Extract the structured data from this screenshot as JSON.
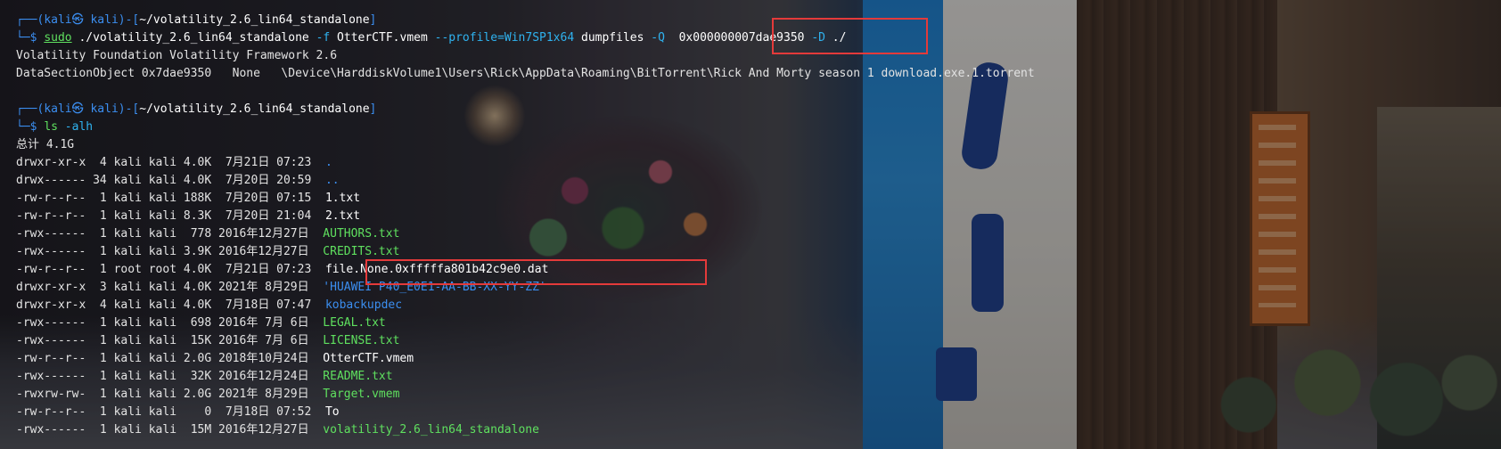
{
  "terminal": {
    "prompt_user": "kali",
    "prompt_host": "kali",
    "prompt_cwd": "~/volatility_2.6_lin64_standalone",
    "prompt_top_prefix": "┌──(",
    "prompt_glyph": "㉿",
    "prompt_mid": ")-[",
    "prompt_top_suffix": "]",
    "prompt_bottom": "└─$",
    "command1": {
      "sudo": "sudo",
      "exe": "./volatility_2.6_lin64_standalone",
      "flag_f": "-f",
      "file": "OtterCTF.vmem",
      "profile_opt": "--profile=Win7SP1x64",
      "plugin": "dumpfiles",
      "flag_Q": "-Q",
      "address": "0x000000007dae9350",
      "flag_D": "-D",
      "dir": "./"
    },
    "output1": [
      "Volatility Foundation Volatility Framework 2.6",
      "DataSectionObject 0x7dae9350   None   \\Device\\HarddiskVolume1\\Users\\Rick\\AppData\\Roaming\\BitTorrent\\Rick And Morty season 1 download.exe.1.torrent"
    ],
    "command2": {
      "exe": "ls",
      "args": "-alh"
    },
    "total_line": "总计 4.1G",
    "listing": [
      {
        "perm": "drwxr-xr-x",
        "links": " 4",
        "owner": "kali",
        "group": "kali",
        "size": "4.0K",
        "date": " 7月21日 07:23",
        "name": ".",
        "kind": "dir"
      },
      {
        "perm": "drwx------",
        "links": "34",
        "owner": "kali",
        "group": "kali",
        "size": "4.0K",
        "date": " 7月20日 20:59",
        "name": "..",
        "kind": "dir"
      },
      {
        "perm": "-rw-r--r--",
        "links": " 1",
        "owner": "kali",
        "group": "kali",
        "size": "188K",
        "date": " 7月20日 07:15",
        "name": "1.txt",
        "kind": "file"
      },
      {
        "perm": "-rw-r--r--",
        "links": " 1",
        "owner": "kali",
        "group": "kali",
        "size": "8.3K",
        "date": " 7月20日 21:04",
        "name": "2.txt",
        "kind": "file"
      },
      {
        "perm": "-rwx------",
        "links": " 1",
        "owner": "kali",
        "group": "kali",
        "size": " 778",
        "date": "2016年12月27日",
        "name": "AUTHORS.txt",
        "kind": "exe"
      },
      {
        "perm": "-rwx------",
        "links": " 1",
        "owner": "kali",
        "group": "kali",
        "size": "3.9K",
        "date": "2016年12月27日",
        "name": "CREDITS.txt",
        "kind": "exe"
      },
      {
        "perm": "-rw-r--r--",
        "links": " 1",
        "owner": "root",
        "group": "root",
        "size": "4.0K",
        "date": " 7月21日 07:23",
        "name": "file.None.0xfffffa801b42c9e0.dat",
        "kind": "file"
      },
      {
        "perm": "drwxr-xr-x",
        "links": " 3",
        "owner": "kali",
        "group": "kali",
        "size": "4.0K",
        "date": "2021年 8月29日",
        "name": "'HUAWEI P40_E0E1-AA-BB-XX-YY-ZZ'",
        "kind": "quoted"
      },
      {
        "perm": "drwxr-xr-x",
        "links": " 4",
        "owner": "kali",
        "group": "kali",
        "size": "4.0K",
        "date": " 7月18日 07:47",
        "name": "kobackupdec",
        "kind": "dir"
      },
      {
        "perm": "-rwx------",
        "links": " 1",
        "owner": "kali",
        "group": "kali",
        "size": " 698",
        "date": "2016年 7月 6日",
        "name": "LEGAL.txt",
        "kind": "exe"
      },
      {
        "perm": "-rwx------",
        "links": " 1",
        "owner": "kali",
        "group": "kali",
        "size": " 15K",
        "date": "2016年 7月 6日",
        "name": "LICENSE.txt",
        "kind": "exe"
      },
      {
        "perm": "-rw-r--r--",
        "links": " 1",
        "owner": "kali",
        "group": "kali",
        "size": "2.0G",
        "date": "2018年10月24日",
        "name": "OtterCTF.vmem",
        "kind": "file"
      },
      {
        "perm": "-rwx------",
        "links": " 1",
        "owner": "kali",
        "group": "kali",
        "size": " 32K",
        "date": "2016年12月24日",
        "name": "README.txt",
        "kind": "exe"
      },
      {
        "perm": "-rwxrw-rw-",
        "links": " 1",
        "owner": "kali",
        "group": "kali",
        "size": "2.0G",
        "date": "2021年 8月29日",
        "name": "Target.vmem",
        "kind": "exe"
      },
      {
        "perm": "-rw-r--r--",
        "links": " 1",
        "owner": "kali",
        "group": "kali",
        "size": "   0",
        "date": " 7月18日 07:52",
        "name": "To",
        "kind": "file"
      },
      {
        "perm": "-rwx------",
        "links": " 1",
        "owner": "kali",
        "group": "kali",
        "size": " 15M",
        "date": "2016年12月27日",
        "name": "volatility_2.6_lin64_standalone",
        "kind": "exe"
      }
    ]
  },
  "colors": {
    "highlight_box": "#e43a3a",
    "prompt_blue": "#3b8ef0",
    "exec_green": "#5fe05f"
  }
}
